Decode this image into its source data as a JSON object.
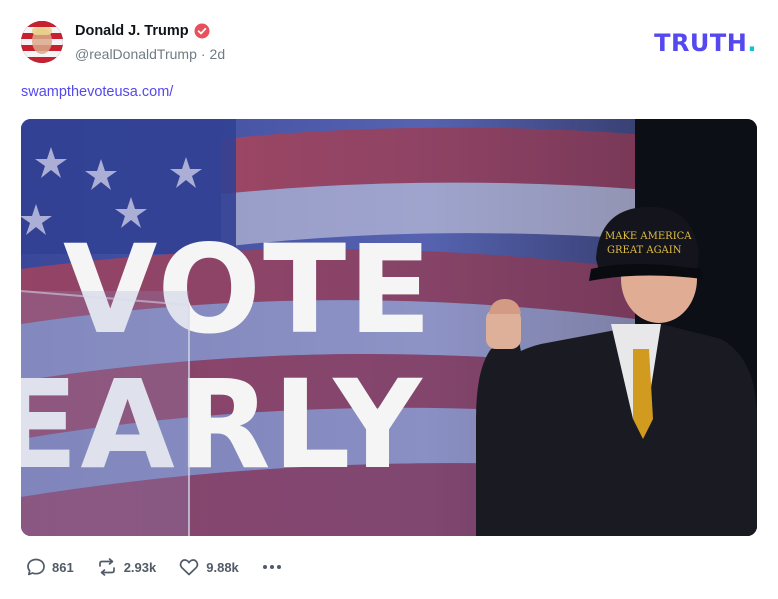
{
  "post": {
    "author": {
      "display_name": "Donald J. Trump",
      "handle": "@realDonaldTrump",
      "separator": "·",
      "age": "2d",
      "verified_color": "#e8505b"
    },
    "brand": {
      "logo_text": "TRUTH",
      "logo_dot": ".",
      "accent": "#5448ee",
      "dot_color": "#17c1c8"
    },
    "link_text": "swampthevoteusa.com/",
    "image": {
      "sign_text_line1": "VOTE",
      "sign_text_line2": "EARLY",
      "hat_text_line1": "MAKE AMERICA",
      "hat_text_line2": "GREAT AGAIN"
    },
    "actions": {
      "replies": "861",
      "retruths": "2.93k",
      "likes": "9.88k"
    },
    "icons": {
      "reply": "speech-bubble-icon",
      "retruth": "repost-arrows-icon",
      "like": "heart-icon",
      "more": "ellipsis-icon"
    }
  }
}
